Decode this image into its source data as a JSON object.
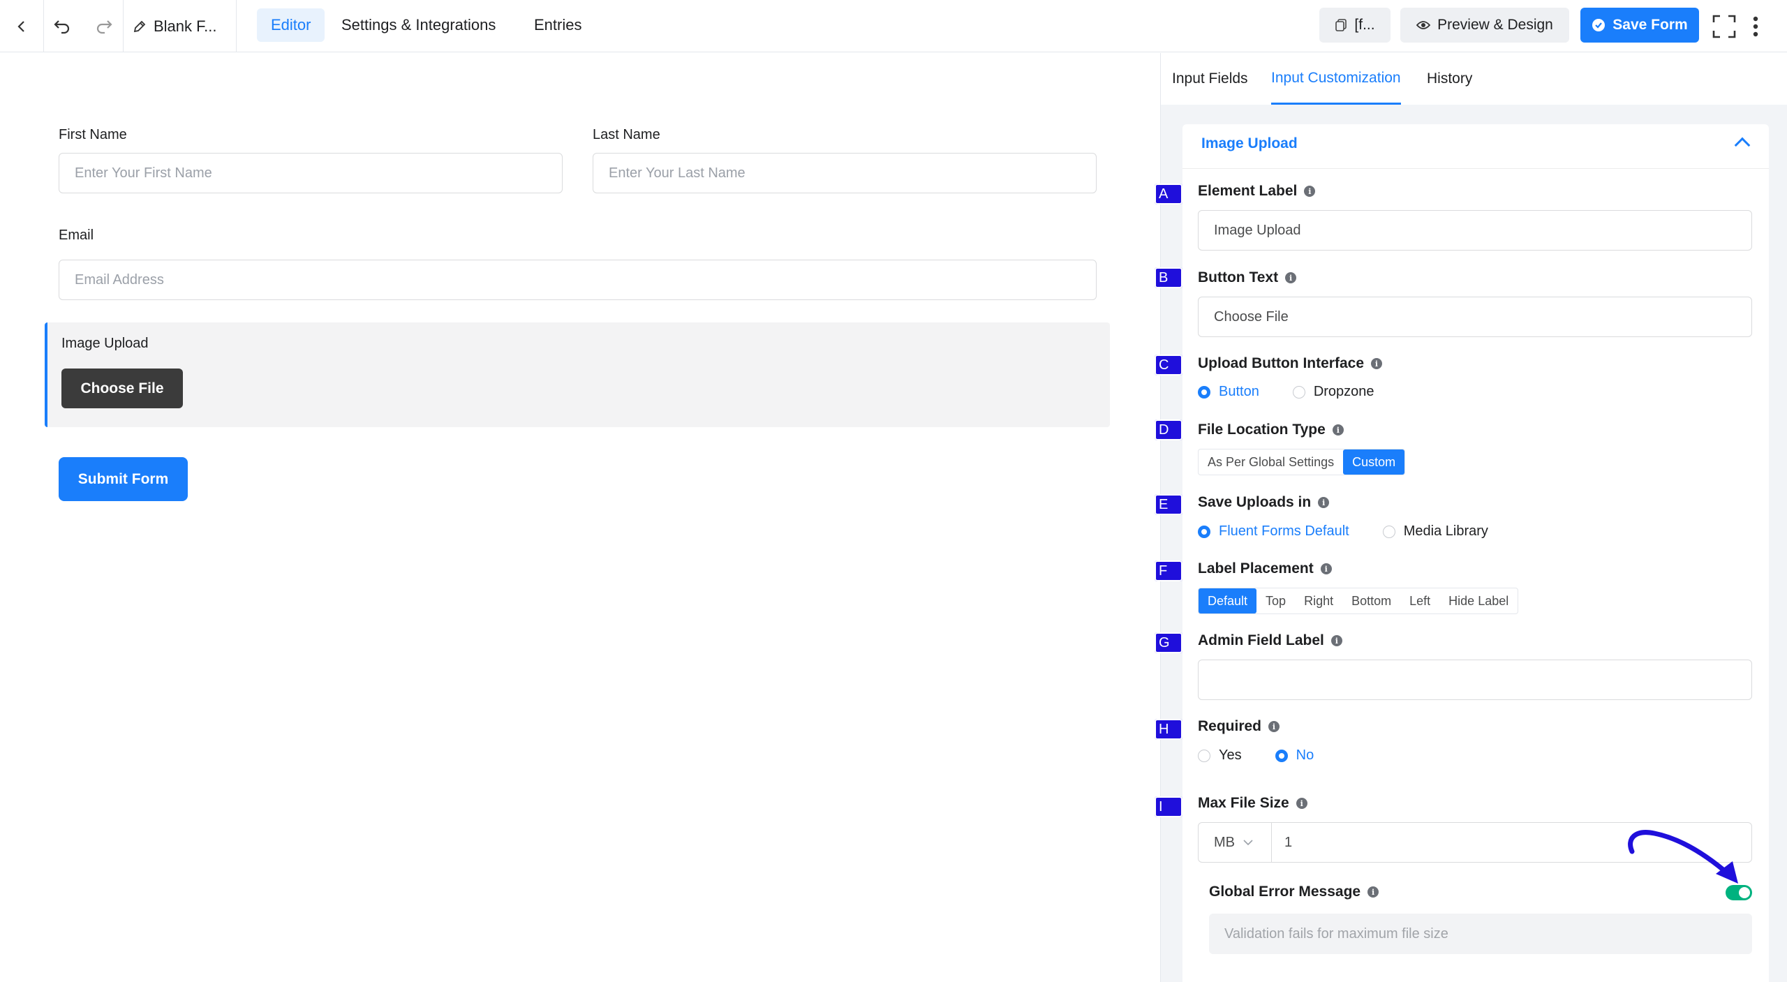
{
  "topbar": {
    "form_name": "Blank F...",
    "tabs": [
      "Editor",
      "Settings & Integrations",
      "Entries"
    ],
    "shortcode": "[f...",
    "preview_label": "Preview & Design",
    "save_label": "Save Form"
  },
  "canvas": {
    "first_name_label": "First Name",
    "first_name_placeholder": "Enter Your First Name",
    "last_name_label": "Last Name",
    "last_name_placeholder": "Enter Your Last Name",
    "email_label": "Email",
    "email_placeholder": "Email Address",
    "image_upload_label": "Image Upload",
    "choose_file": "Choose File",
    "submit": "Submit Form"
  },
  "sidebar": {
    "tabs": [
      "Input Fields",
      "Input Customization",
      "History"
    ],
    "panel_title": "Image Upload",
    "badges": [
      "A",
      "B",
      "C",
      "D",
      "E",
      "F",
      "G",
      "H",
      "I"
    ],
    "element_label": {
      "label": "Element Label",
      "value": "Image Upload"
    },
    "button_text": {
      "label": "Button Text",
      "value": "Choose File"
    },
    "upload_interface": {
      "label": "Upload Button Interface",
      "options": [
        "Button",
        "Dropzone"
      ],
      "selected": "Button"
    },
    "file_location": {
      "label": "File Location Type",
      "options": [
        "As Per Global Settings",
        "Custom"
      ],
      "selected": "Custom"
    },
    "save_uploads": {
      "label": "Save Uploads in",
      "options": [
        "Fluent Forms Default",
        "Media Library"
      ],
      "selected": "Fluent Forms Default"
    },
    "label_placement": {
      "label": "Label Placement",
      "options": [
        "Default",
        "Top",
        "Right",
        "Bottom",
        "Left",
        "Hide Label"
      ],
      "selected": "Default"
    },
    "admin_label": {
      "label": "Admin Field Label",
      "value": ""
    },
    "required": {
      "label": "Required",
      "options": [
        "Yes",
        "No"
      ],
      "selected": "No"
    },
    "max_file_size": {
      "label": "Max File Size",
      "unit": "MB",
      "value": "1"
    },
    "global_error": {
      "label": "Global Error Message",
      "enabled": true,
      "placeholder": "Validation fails for maximum file size"
    }
  },
  "colors": {
    "accent": "#1a7efb",
    "badge": "#1f0fdb",
    "toggle_on": "#00b27f",
    "upload_button": "#3b3b3b"
  }
}
